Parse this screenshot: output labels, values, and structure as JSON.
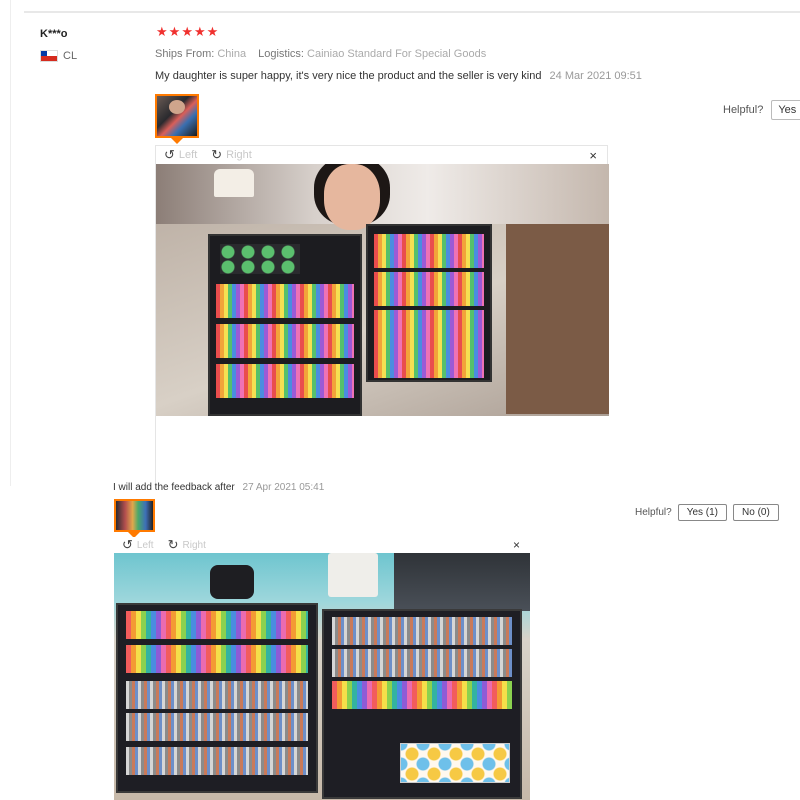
{
  "review": {
    "reviewer_name": "K***o",
    "country_code": "CL",
    "rating": 5,
    "stars": [
      "★",
      "★",
      "★",
      "★",
      "★"
    ],
    "ships_from_label": "Ships From:",
    "ships_from_value": "China",
    "logistics_label": "Logistics:",
    "logistics_value": "Cainiao Standard For Special Goods",
    "text": "My daughter is super happy, it's very nice the product and the seller is very kind",
    "date": "24 Mar 2021 09:51",
    "helpful_label": "Helpful?",
    "yes_label": "Yes"
  },
  "viewer": {
    "left_label": "Left",
    "right_label": "Right",
    "rotate_left_icon": "↺",
    "rotate_right_icon": "↻",
    "close_icon": "×"
  },
  "followup": {
    "text": "I will add the feedback after",
    "date": "27 Apr 2021 05:41",
    "helpful_label": "Helpful?",
    "yes_label": "Yes (1)",
    "no_label": "No (0)"
  },
  "colors": {
    "star": "#f0312f",
    "thumb_border": "#ff7a00"
  }
}
